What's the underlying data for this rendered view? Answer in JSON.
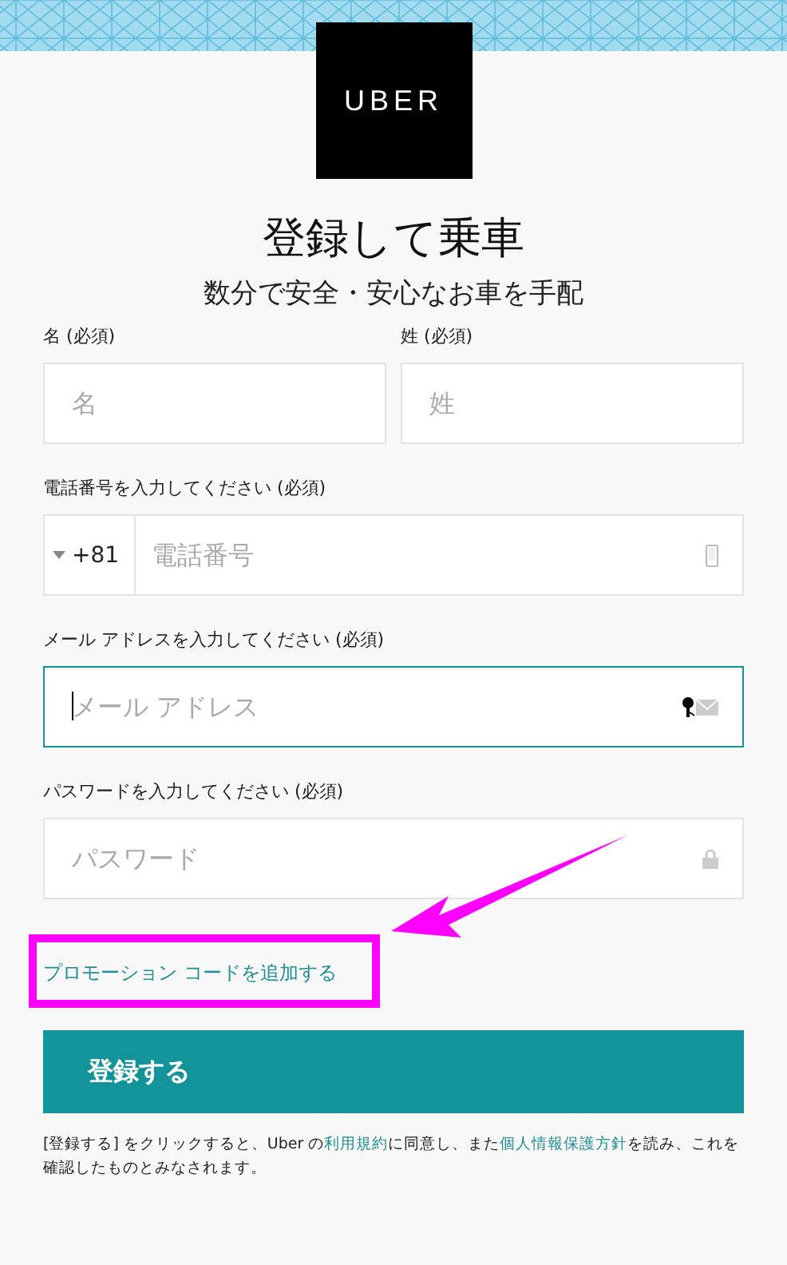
{
  "logo": "UBER",
  "title": "登録して乗車",
  "subtitle": "数分で安全・安心なお車を手配",
  "name_fields": [
    {
      "label": "名 (必須)",
      "placeholder": "名"
    },
    {
      "label": "姓 (必須)",
      "placeholder": "姓"
    }
  ],
  "fields": [
    {
      "kind": "phone",
      "label": "電話番号を入力してください (必須)",
      "prefix": "+81",
      "placeholder": "電話番号",
      "focused": false
    },
    {
      "kind": "email",
      "label": "メール アドレスを入力してください (必須)",
      "placeholder": "メール アドレス",
      "focused": true
    },
    {
      "kind": "password",
      "label": "パスワードを入力してください (必須)",
      "placeholder": "パスワード",
      "focused": false
    }
  ],
  "promo_link": {
    "text": "プロモーション コードを追加する",
    "highlighted": true
  },
  "submit_button": "登録する",
  "terms": [
    {
      "text": "[登録する] をクリックすると、Uber の",
      "link": false
    },
    {
      "text": "利用規約",
      "link": true
    },
    {
      "text": "に同意し、また",
      "link": false
    },
    {
      "text": "個人情報保護方針",
      "link": true
    },
    {
      "text": "を読み、これを確認したものとみなされます。",
      "link": false
    }
  ]
}
